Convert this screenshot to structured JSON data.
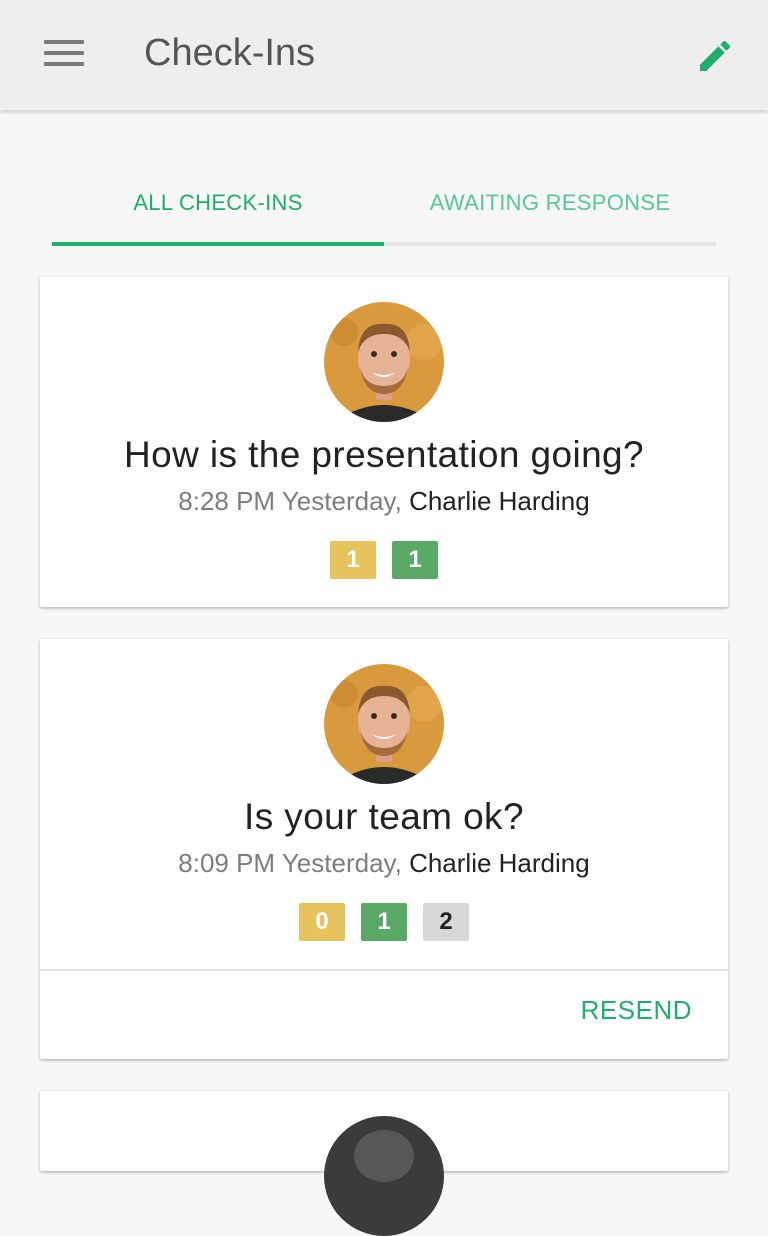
{
  "header": {
    "title": "Check-Ins",
    "menu_icon": "hamburger-menu-icon",
    "edit_icon": "pencil-icon",
    "accent_color": "#1fae6b"
  },
  "tabs": [
    {
      "label": "ALL CHECK-INS",
      "selected": true
    },
    {
      "label": "AWAITING RESPONSE",
      "selected": false
    }
  ],
  "checkins": [
    {
      "question": "How is the presentation going?",
      "time": "8:28 PM Yesterday,",
      "author": "Charlie Harding",
      "badges": [
        {
          "value": "1",
          "color": "#e6c35c"
        },
        {
          "value": "1",
          "color": "#5aa865"
        }
      ]
    },
    {
      "question": "Is your team ok?",
      "time": "8:09 PM Yesterday,",
      "author": "Charlie Harding",
      "badges": [
        {
          "value": "0",
          "color": "#e6c35c"
        },
        {
          "value": "1",
          "color": "#5aa865"
        },
        {
          "value": "2",
          "color": "#d8d8d8"
        }
      ],
      "action_label": "RESEND"
    }
  ]
}
